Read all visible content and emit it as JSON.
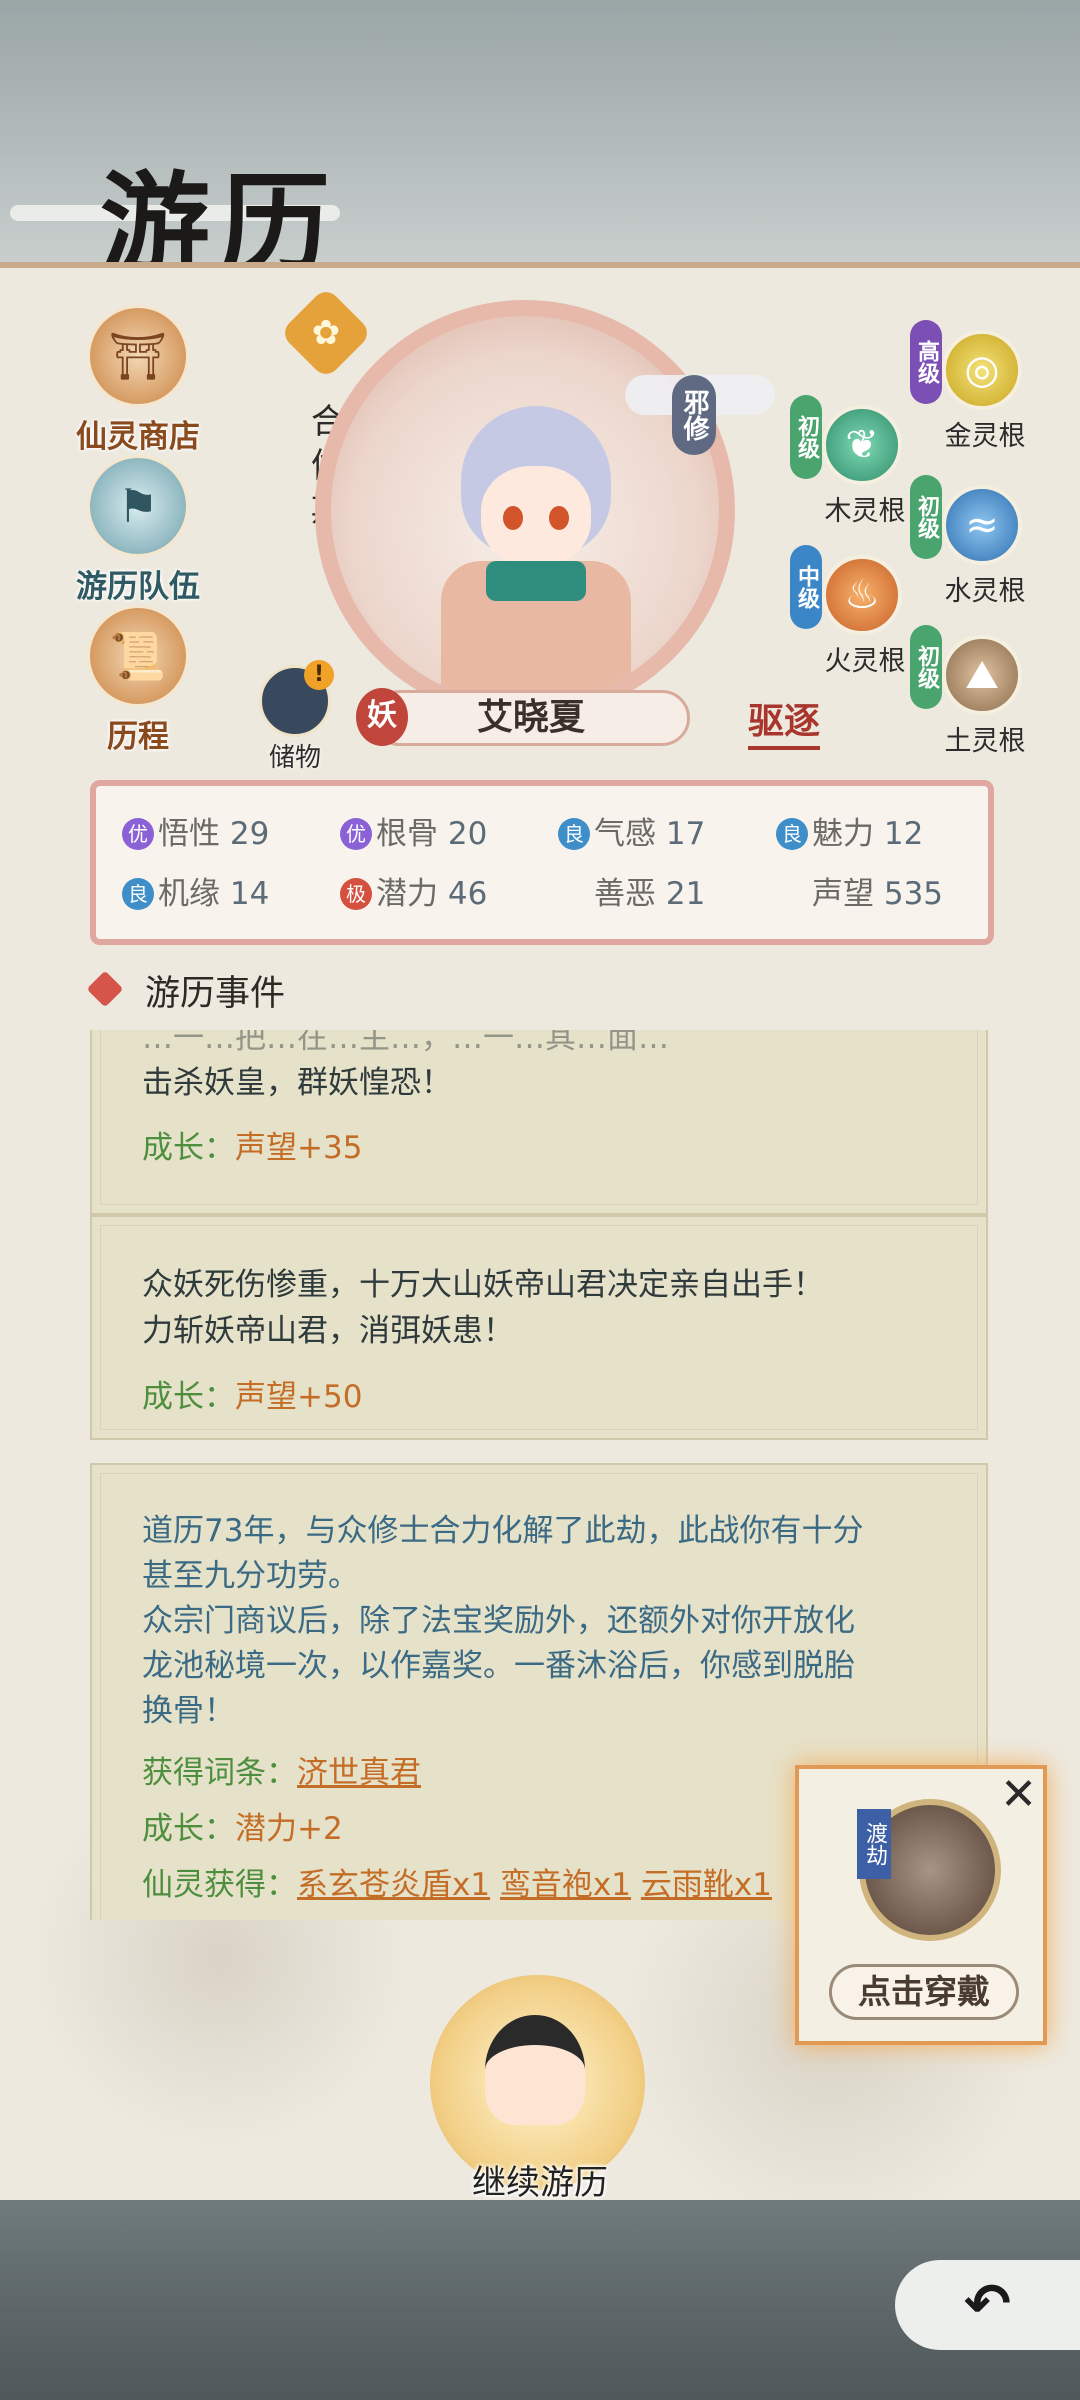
{
  "header": {
    "title": "游历"
  },
  "menu": {
    "shop": "仙灵商店",
    "team": "游历队伍",
    "history": "历程"
  },
  "character": {
    "realm": "合体期",
    "sect": "邪修",
    "race": "妖",
    "name": "艾晓夏",
    "storage": "储物",
    "expel": "驱逐"
  },
  "roots": [
    {
      "grade": "高级",
      "name": "金灵根",
      "color": "#c9a51e"
    },
    {
      "grade": "初级",
      "name": "木灵根",
      "color": "#2f8d6b"
    },
    {
      "grade": "初级",
      "name": "水灵根",
      "color": "#2f6fb0"
    },
    {
      "grade": "中级",
      "name": "火灵根",
      "color": "#c8602a"
    },
    {
      "grade": "初级",
      "name": "土灵根",
      "color": "#8a6a4a"
    }
  ],
  "stats": [
    {
      "badge": "优",
      "label": "悟性",
      "value": "29"
    },
    {
      "badge": "优",
      "label": "根骨",
      "value": "20"
    },
    {
      "badge": "良",
      "label": "气感",
      "value": "17"
    },
    {
      "badge": "良",
      "label": "魅力",
      "value": "12"
    },
    {
      "badge": "良",
      "label": "机缘",
      "value": "14"
    },
    {
      "badge": "极",
      "label": "潜力",
      "value": "46"
    },
    {
      "badge": "",
      "label": "善恶",
      "value": "21"
    },
    {
      "badge": "",
      "label": "声望",
      "value": "535"
    }
  ],
  "events_title": "游历事件",
  "events": [
    {
      "partial": "…一…把…在…主…，…一…其…面…",
      "text": "击杀妖皇，群妖惶恐！",
      "growth_label": "成长：",
      "growth_value": "声望+35"
    },
    {
      "text1": "众妖死伤惨重，十万大山妖帝山君决定亲自出手！",
      "text2": "力斩妖帝山君，消弭妖患！",
      "growth_label": "成长：",
      "growth_value": "声望+50"
    },
    {
      "text1": "道历73年，与众修士合力化解了此劫，此战你有十分",
      "text2": "甚至九分功劳。",
      "text3": "众宗门商议后，除了法宝奖励外，还额外对你开放化",
      "text4": "龙池秘境一次，以作嘉奖。一番沐浴后，你感到脱胎",
      "text5": "换骨！",
      "entry_label": "获得词条：",
      "entry_value": "济世真君",
      "growth_label": "成长：",
      "growth_value": "潜力+2",
      "loot_label": "仙灵获得：",
      "loot_items": [
        "系玄苍炎盾x1",
        "鸾音袍x1",
        "云雨靴x1"
      ]
    }
  ],
  "popup": {
    "tag": "渡劫",
    "button": "点击穿戴",
    "close": "✕"
  },
  "continue_label": "继续游历",
  "back_icon": "↶"
}
